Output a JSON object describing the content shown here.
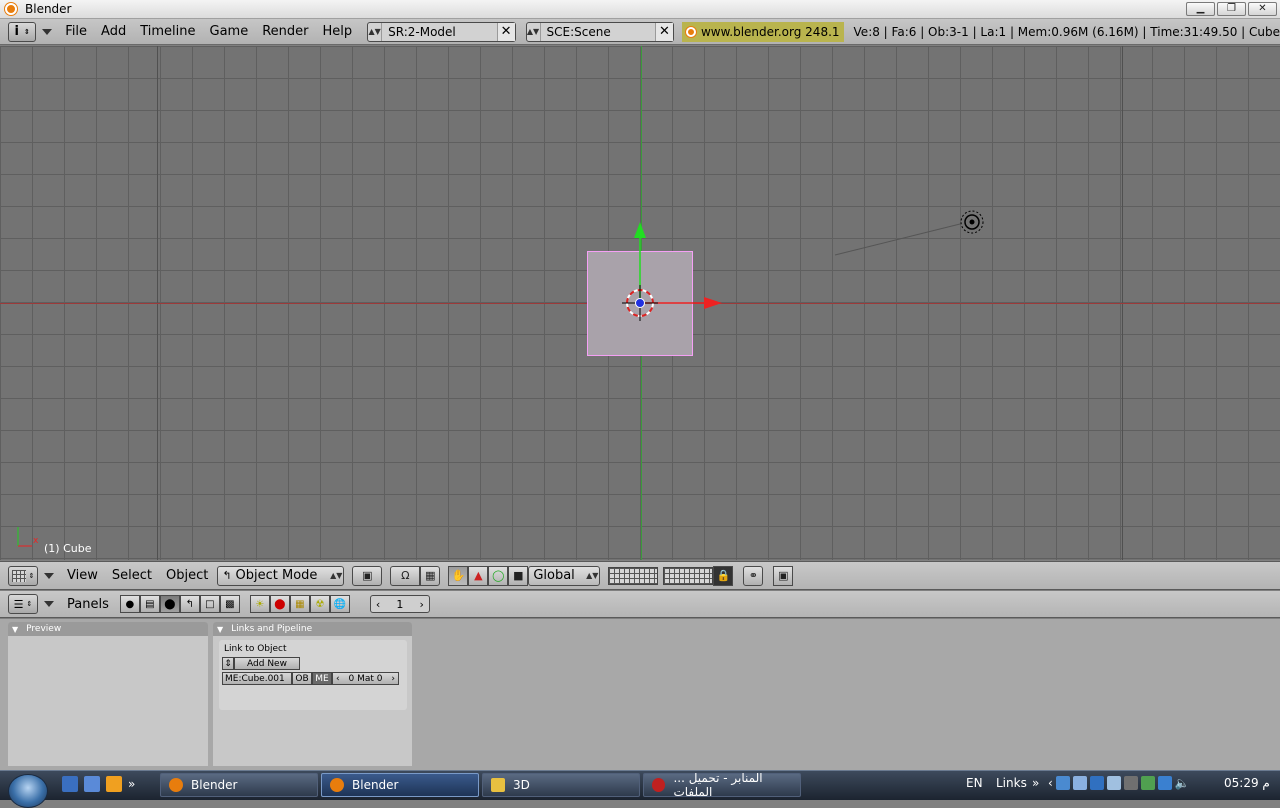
{
  "window": {
    "title": "Blender",
    "minimize": "▁",
    "maximize": "❐",
    "close": "✕"
  },
  "infobar": {
    "info_icon": "i",
    "menus": [
      "File",
      "Add",
      "Timeline",
      "Game",
      "Render",
      "Help"
    ],
    "screen_field": "SR:2-Model",
    "scene_field": "SCE:Scene",
    "blender_link": "www.blender.org 248.1",
    "stats": "Ve:8 | Fa:6 | Ob:3-1 | La:1  | Mem:0.96M (6.16M)  | Time:31:49.50 | Cube"
  },
  "viewport": {
    "object_label": "(1) Cube",
    "axis_x_label": "x",
    "axis_colors": {
      "x": "#c83232",
      "y": "#28c828",
      "z": "#1e1ecf"
    }
  },
  "view_header": {
    "menus": [
      "View",
      "Select",
      "Object"
    ],
    "mode": "Object Mode",
    "orientation": "Global"
  },
  "buttons_header": {
    "panels_label": "Panels",
    "frame_value": "1"
  },
  "panels": {
    "preview_title": "Preview",
    "links_title": "Links and Pipeline",
    "link_to_object": "Link to Object",
    "add_new": "Add New",
    "mesh_name": "ME:Cube.001",
    "ob_btn": "OB",
    "me_btn": "ME",
    "mat_field": "0 Mat 0"
  },
  "taskbar": {
    "tasks": [
      "Blender",
      "Blender",
      "3D",
      "... المنابر - تحميل الملفات"
    ],
    "lang": "EN",
    "links": "Links",
    "chevron": "»",
    "clock": "م 05:29"
  }
}
